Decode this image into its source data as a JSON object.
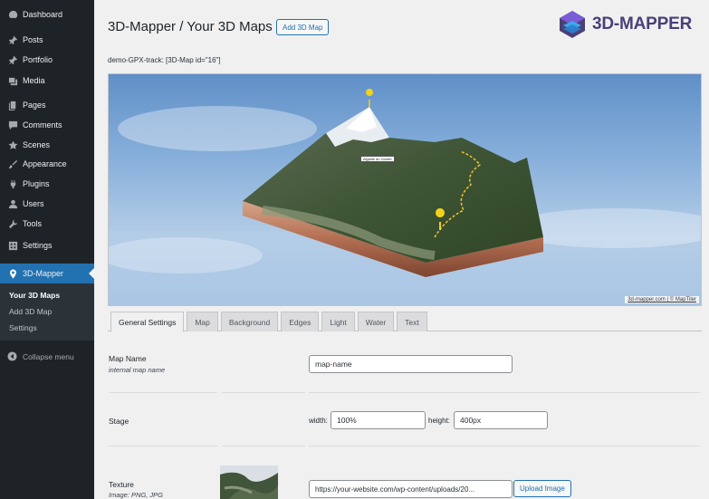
{
  "sidebar": {
    "items": [
      {
        "label": "Dashboard",
        "icon": "dashboard-icon"
      },
      {
        "label": "Posts",
        "icon": "pin-icon"
      },
      {
        "label": "Portfolio",
        "icon": "pin-icon"
      },
      {
        "label": "Media",
        "icon": "media-icon"
      },
      {
        "label": "Pages",
        "icon": "pages-icon"
      },
      {
        "label": "Comments",
        "icon": "comments-icon"
      },
      {
        "label": "Scenes",
        "icon": "star-icon"
      },
      {
        "label": "Appearance",
        "icon": "brush-icon"
      },
      {
        "label": "Plugins",
        "icon": "plugin-icon"
      },
      {
        "label": "Users",
        "icon": "user-icon"
      },
      {
        "label": "Tools",
        "icon": "wrench-icon"
      },
      {
        "label": "Settings",
        "icon": "settings-icon"
      },
      {
        "label": "3D-Mapper",
        "icon": "location-pin-icon"
      }
    ],
    "submenu": [
      "Your 3D Maps",
      "Add 3D Map",
      "Settings"
    ],
    "collapse_label": "Collapse menu"
  },
  "header": {
    "title": "3D-Mapper / Your 3D Maps",
    "add_button": "Add 3D Map",
    "logo_text": "3D-MAPPER"
  },
  "shortcode": "demo-GPX-track: [3D-Map id=\"16\"]",
  "map": {
    "attribution": "3d-mapper.com | © MapTiler",
    "marker_label": "Aiguille du Goûter"
  },
  "tabs": [
    "General Settings",
    "Map",
    "Background",
    "Edges",
    "Light",
    "Water",
    "Text"
  ],
  "form": {
    "map_name": {
      "label": "Map Name",
      "desc": "internal map name",
      "value": "map-name"
    },
    "stage": {
      "label": "Stage",
      "width_label": "width:",
      "width_value": "100%",
      "height_label": "height:",
      "height_value": "400px"
    },
    "texture": {
      "label": "Texture",
      "desc": "Image: PNG, JPG",
      "url": "https://your-website.com/wp-content/uploads/20...",
      "upload_button": "Upload Image"
    }
  },
  "colors": {
    "sidebar_bg": "#1d2327",
    "accent": "#2271b1",
    "logo": "#4a3f77"
  }
}
